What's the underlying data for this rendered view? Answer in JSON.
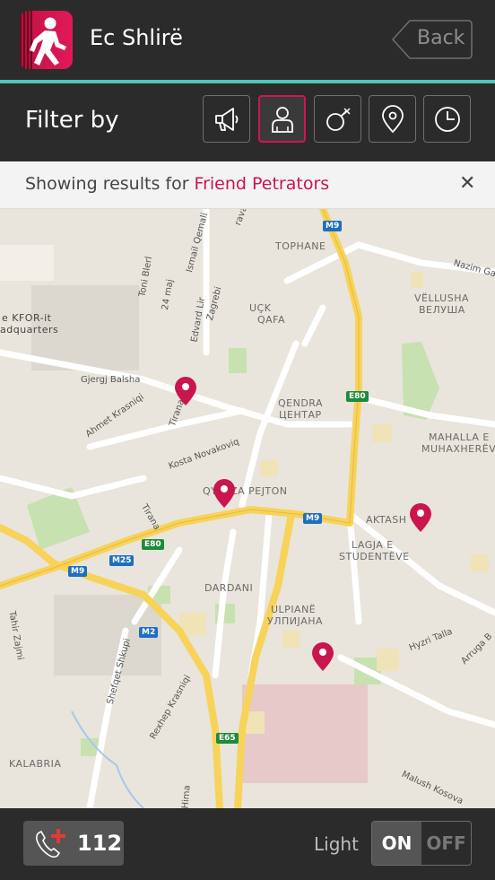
{
  "header": {
    "app_title": "Ec Shlirë",
    "back_label": "Back",
    "logo_icon": "walking-person-icon"
  },
  "filter": {
    "label": "Filter by",
    "buttons": [
      {
        "icon": "megaphone-icon",
        "active": false
      },
      {
        "icon": "person-icon",
        "active": true
      },
      {
        "icon": "male-symbol-icon",
        "active": false
      },
      {
        "icon": "location-pin-icon",
        "active": false
      },
      {
        "icon": "clock-icon",
        "active": false
      }
    ]
  },
  "results": {
    "prefix": "Showing results for ",
    "highlight": "Friend Petrators",
    "close_label": "✕"
  },
  "map": {
    "labels": {
      "tophane": "TOPHANE",
      "vellusha": "VËLLUSHA",
      "vellusha_cyr": "ВЕЛУША",
      "uck": "UÇK",
      "qafa": "QAFA",
      "qendra": "QENDRA",
      "qendra_cyr": "ЦЕНТАР",
      "mahalla": "MAHALLA E",
      "muhaxhereve": "MUHAXHERËVE",
      "qyteza": "QYTEZA PEJTON",
      "aktash": "AKTASH",
      "lagja": "LAGJA E",
      "studenteve": "STUDENTËVE",
      "dardani": "DARDANI",
      "ulpiane": "ULPIANË",
      "ulpiane_cyr": "УЛПИЈАНА",
      "kalabria": "KALABRIA",
      "kfor": "e KFOR-it",
      "headquarters": "adquarters"
    },
    "roads": {
      "nazim": "Nazim Gafi",
      "toni_bleri": "Toni Blerl",
      "ismail": "Ismail Qemali",
      "maj24": "24 maj",
      "edvard": "Edvard Lir",
      "zagreb": "Zagrebi",
      "gjergj": "Gjergj Balsha",
      "ahmet": "Ahmet Krasniqi",
      "tirana1": "Tirana",
      "kosta": "Kosta Novakoviq",
      "tirana2": "Tirana",
      "tahir": "Tahir Zajmi",
      "shefqet": "Shefqet Shkupi",
      "rexhep": "Rexhep Krasniqi",
      "hyzri": "Hyzri Talla",
      "arruga": "Arruga B",
      "malush": "Malush Kosova",
      "hima": "Hima",
      "rava": "rava"
    },
    "shields": {
      "m9_top": "M9",
      "e80_top": "E80",
      "m9_mid": "M9",
      "e80_left": "E80",
      "m25": "M25",
      "m9_left": "M9",
      "m2": "M2",
      "e65": "E65"
    },
    "pins": [
      {
        "id": "pin-1"
      },
      {
        "id": "pin-2"
      },
      {
        "id": "pin-3"
      },
      {
        "id": "pin-4"
      }
    ]
  },
  "bottom": {
    "emergency_number": "112",
    "light_label": "Light",
    "toggle_on": "ON",
    "toggle_off": "OFF",
    "light_state": "ON"
  },
  "colors": {
    "accent": "#d01552",
    "teal": "#4fc7b8",
    "background": "#2b2b2b"
  }
}
